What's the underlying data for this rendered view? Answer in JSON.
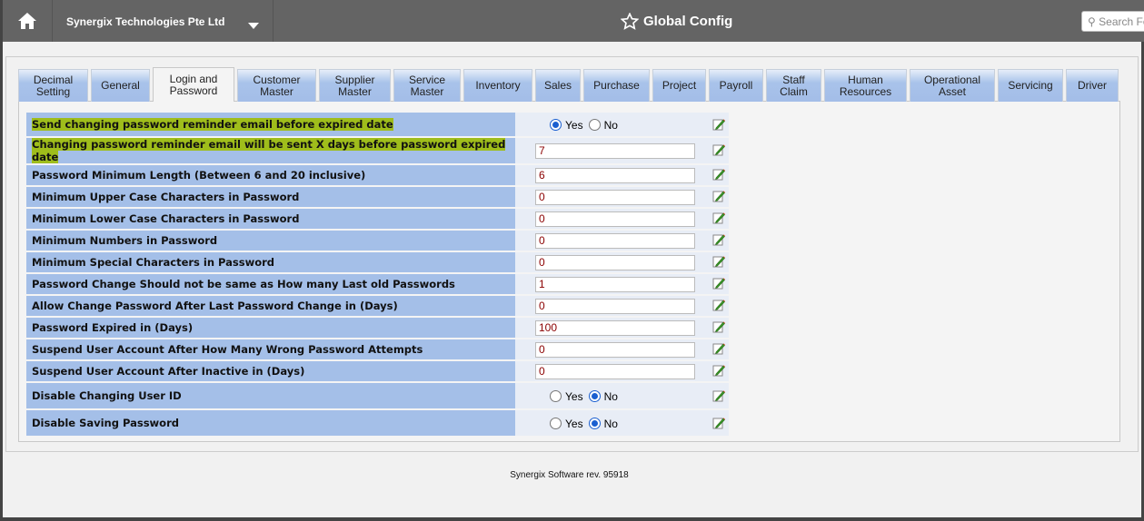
{
  "header": {
    "company": "Synergix Technologies Pte Ltd",
    "title": "Global Config",
    "search_placeholder": "Search Fo"
  },
  "tabs": [
    {
      "label": "Decimal Setting",
      "active": false
    },
    {
      "label": "General",
      "active": false
    },
    {
      "label": "Login and Password",
      "active": true
    },
    {
      "label": "Customer Master"
    },
    {
      "label": "Supplier Master"
    },
    {
      "label": "Service Master"
    },
    {
      "label": "Inventory"
    },
    {
      "label": "Sales"
    },
    {
      "label": "Purchase"
    },
    {
      "label": "Project"
    },
    {
      "label": "Payroll"
    },
    {
      "label": "Staff Claim"
    },
    {
      "label": "Human Resources"
    },
    {
      "label": "Operational Asset"
    },
    {
      "label": "Servicing"
    },
    {
      "label": "Driver"
    }
  ],
  "radio_labels": {
    "yes": "Yes",
    "no": "No"
  },
  "rows": [
    {
      "label": "Send changing password reminder email before expired date",
      "type": "radio",
      "value": "Yes",
      "highlight": true
    },
    {
      "label": "Changing password reminder email will be sent X days before password expired date",
      "type": "text",
      "value": "7",
      "highlight": true
    },
    {
      "label": "Password Minimum Length (Between 6 and 20 inclusive)",
      "type": "text",
      "value": "6"
    },
    {
      "label": "Minimum Upper Case Characters in Password",
      "type": "text",
      "value": "0"
    },
    {
      "label": "Minimum Lower Case Characters in Password",
      "type": "text",
      "value": "0"
    },
    {
      "label": "Minimum Numbers in Password",
      "type": "text",
      "value": "0"
    },
    {
      "label": "Minimum Special Characters in Password",
      "type": "text",
      "value": "0"
    },
    {
      "label": "Password Change Should not be same as How many Last old Passwords",
      "type": "text",
      "value": "1"
    },
    {
      "label": "Allow Change Password After Last Password Change in (Days)",
      "type": "text",
      "value": "0"
    },
    {
      "label": "Password Expired in (Days)",
      "type": "text",
      "value": "100"
    },
    {
      "label": "Suspend User Account After How Many Wrong Password Attempts",
      "type": "text",
      "value": "0"
    },
    {
      "label": "Suspend User Account After Inactive in (Days)",
      "type": "text",
      "value": "0"
    },
    {
      "label": "Disable Changing User ID",
      "type": "radio",
      "value": "No"
    },
    {
      "label": "Disable Saving Password",
      "type": "radio",
      "value": "No"
    }
  ],
  "footer": "Synergix Software rev. 95918"
}
